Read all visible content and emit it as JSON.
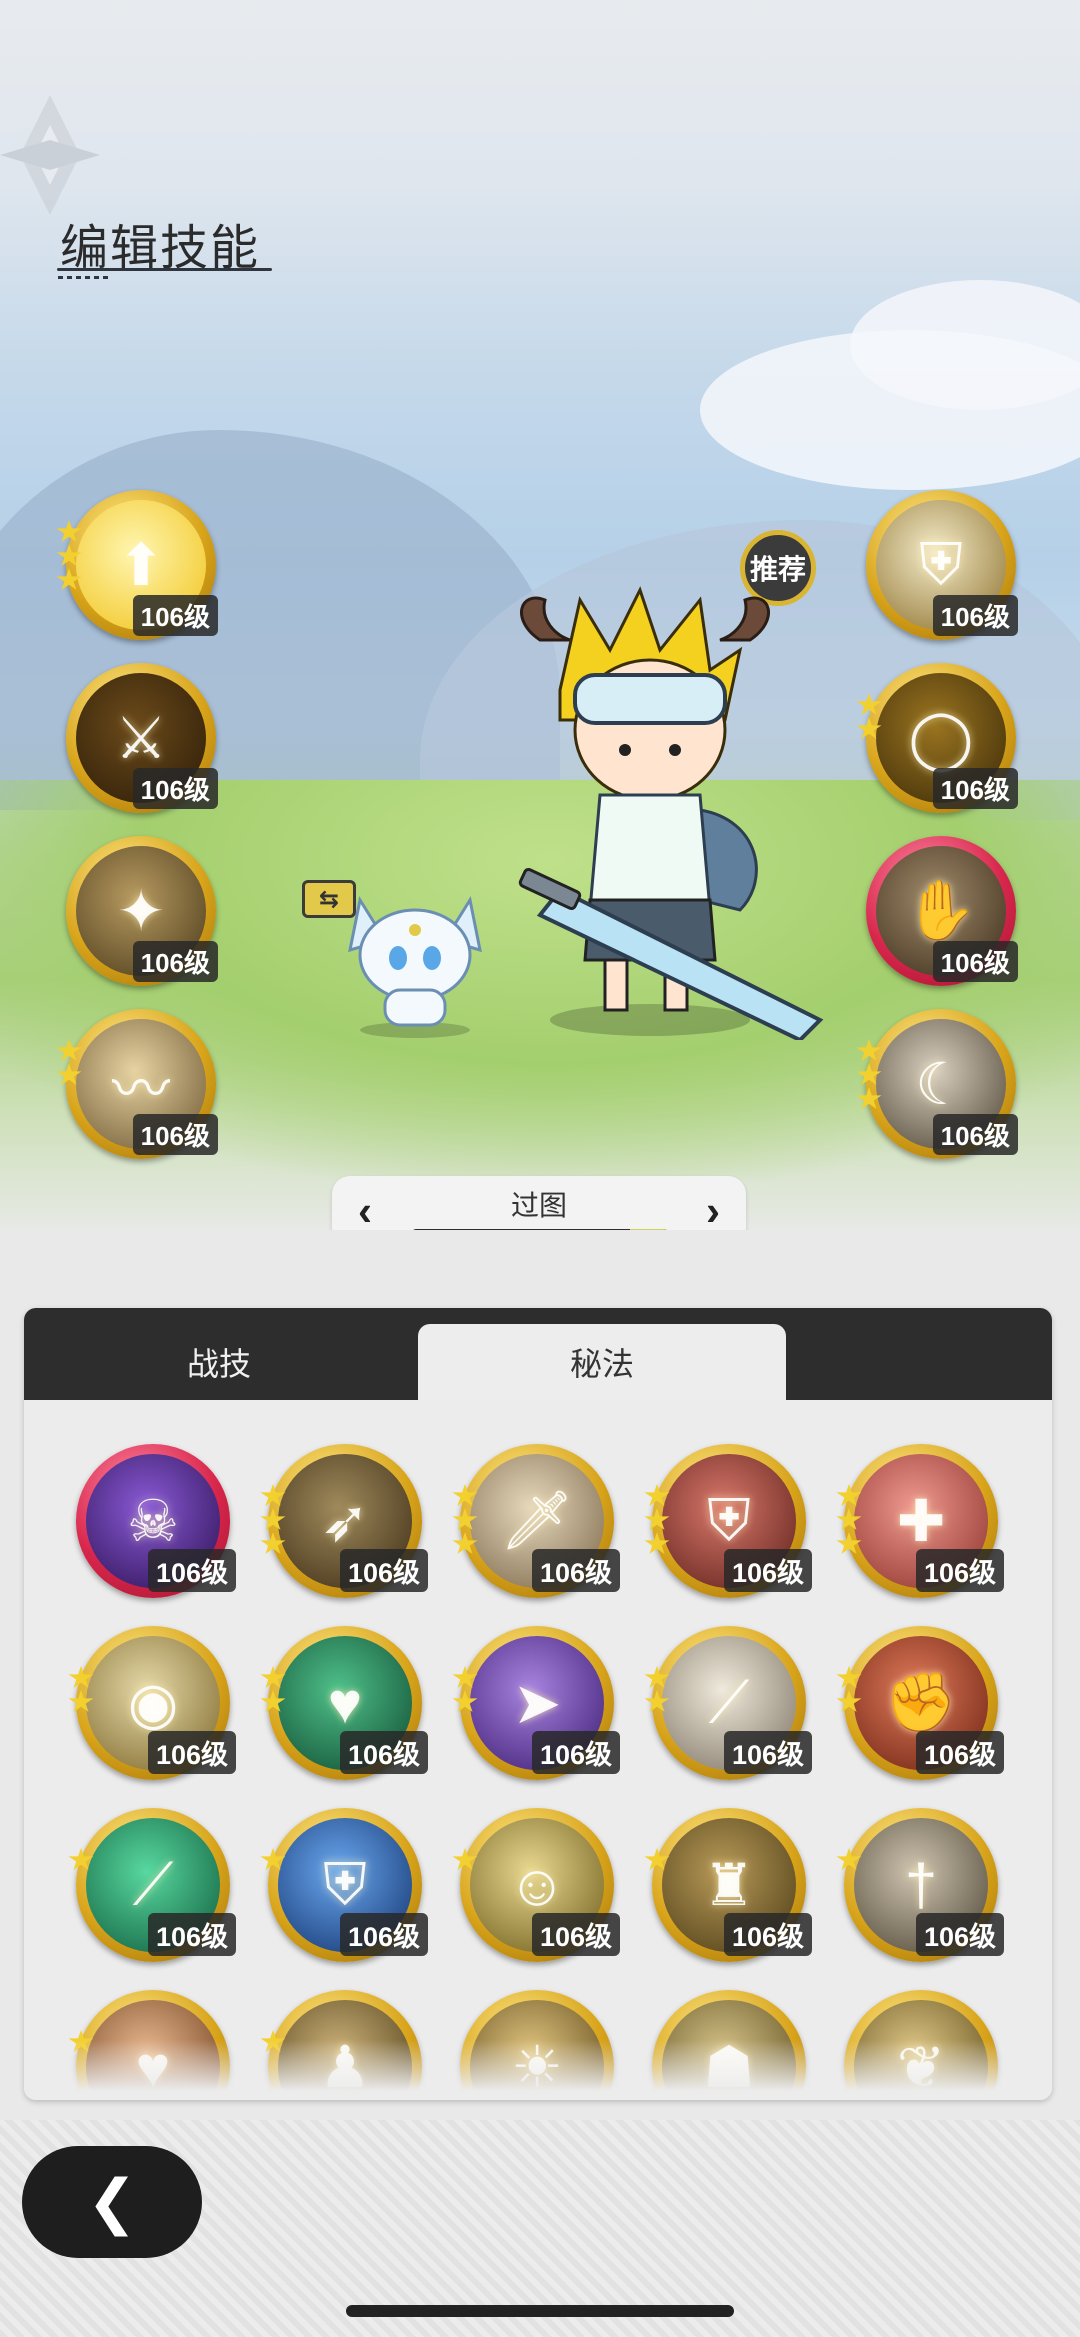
{
  "header": {
    "title": "编辑技能"
  },
  "recommend_label": "推荐",
  "level_text": "106级",
  "equipped_left": [
    {
      "icon": "golden-upgrade-icon",
      "stars": 3,
      "variant": "gold"
    },
    {
      "icon": "golden-swords-icon",
      "stars": 0,
      "variant": "gold"
    },
    {
      "icon": "sparkle-star-icon",
      "stars": 0,
      "variant": "gold"
    },
    {
      "icon": "wind-swirl-icon",
      "stars": 2,
      "variant": "gold"
    }
  ],
  "equipped_right": [
    {
      "icon": "shield-icon",
      "stars": 0,
      "variant": "gold"
    },
    {
      "icon": "golden-ring-icon",
      "stars": 2,
      "variant": "gold"
    },
    {
      "icon": "claw-strike-icon",
      "stars": 0,
      "variant": "red"
    },
    {
      "icon": "crescent-slash-icon",
      "stars": 3,
      "variant": "gold"
    }
  ],
  "map_selector": {
    "label": "过图",
    "progress": 0.15
  },
  "tabs": [
    {
      "label": "战技",
      "active": false
    },
    {
      "label": "秘法",
      "active": true
    }
  ],
  "skills": [
    {
      "icon": "purple-demon-icon",
      "stars": 0,
      "variant": "red"
    },
    {
      "icon": "arrows-burst-icon",
      "stars": 3,
      "variant": "gold"
    },
    {
      "icon": "sword-up-icon",
      "stars": 3,
      "variant": "gold"
    },
    {
      "icon": "shield-break-icon",
      "stars": 3,
      "variant": "gold"
    },
    {
      "icon": "sword-plus-icon",
      "stars": 3,
      "variant": "gold"
    },
    {
      "icon": "eye-icon",
      "stars": 2,
      "variant": "gold"
    },
    {
      "icon": "heart-plus-icon",
      "stars": 2,
      "variant": "gold"
    },
    {
      "icon": "beast-charge-icon",
      "stars": 2,
      "variant": "gold"
    },
    {
      "icon": "blade-light-icon",
      "stars": 2,
      "variant": "gold"
    },
    {
      "icon": "fist-icon",
      "stars": 2,
      "variant": "gold"
    },
    {
      "icon": "green-blade-icon",
      "stars": 1,
      "variant": "gold"
    },
    {
      "icon": "blue-shield-icon",
      "stars": 1,
      "variant": "gold"
    },
    {
      "icon": "person-plus-icon",
      "stars": 1,
      "variant": "gold"
    },
    {
      "icon": "armor-icon",
      "stars": 1,
      "variant": "gold"
    },
    {
      "icon": "sword-down-icon",
      "stars": 1,
      "variant": "gold"
    },
    {
      "icon": "heart-shield-icon",
      "stars": 1,
      "variant": "gold"
    },
    {
      "icon": "figure-icon",
      "stars": 1,
      "variant": "gold"
    },
    {
      "icon": "puzzle-sun-icon",
      "stars": 0,
      "variant": "gold"
    },
    {
      "icon": "golem-icon",
      "stars": 0,
      "variant": "gold"
    },
    {
      "icon": "hearts-icon",
      "stars": 0,
      "variant": "gold"
    }
  ]
}
